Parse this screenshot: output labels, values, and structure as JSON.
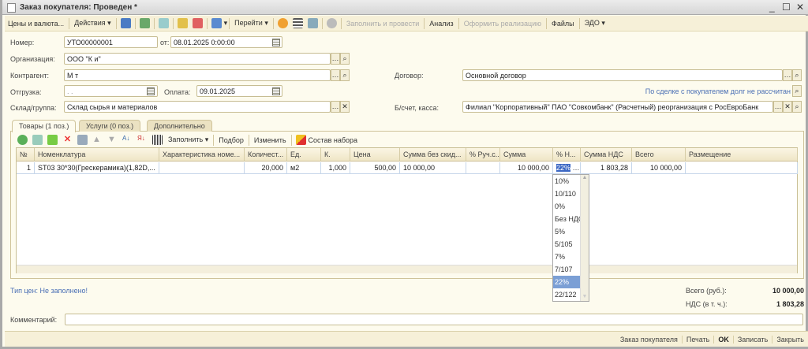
{
  "window": {
    "title": "Заказ покупателя: Проведен *",
    "minimize": "_",
    "maximize": "☐",
    "close": "✕"
  },
  "toolbar": {
    "prices": "Цены и валюта...",
    "actions": "Действия",
    "goto": "Перейти",
    "fill_post": "Заполнить и провести",
    "analysis": "Анализ",
    "make_sale": "Оформить реализацию",
    "files": "Файлы",
    "edo": "ЭДО"
  },
  "form": {
    "number_label": "Номер:",
    "number": "УТО00000001",
    "date_label": "от:",
    "date": "08.01.2025  0:00:00",
    "org_label": "Организация:",
    "org": "ООО \"К                              и\"",
    "contractor_label": "Контрагент:",
    "contractor": "М                       т",
    "contract_label": "Договор:",
    "contract": "Основной договор",
    "shipment_label": "Отгрузка:",
    "shipment": " .  .",
    "payment_label": "Оплата:",
    "payment": "09.01.2025",
    "debt_link": "По сделке с покупателем долг не рассчитан",
    "warehouse_label": "Склад/группа:",
    "warehouse": "Склад сырья и материалов",
    "account_label": "Б/счет, касса:",
    "account": "Филиал \"Корпоративный\" ПАО \"Совкомбанк\" (Расчетный) реорганизация с РосЕвроБанк"
  },
  "tabs": [
    {
      "label": "Товары (1 поз.)"
    },
    {
      "label": "Услуги (0 поз.)"
    },
    {
      "label": "Дополнительно"
    }
  ],
  "table_toolbar": {
    "fill": "Заполнить",
    "select": "Подбор",
    "change": "Изменить",
    "set": "Состав набора"
  },
  "table": {
    "columns": [
      "№",
      "Номенклатура",
      "Характеристика номе...",
      "Количест...",
      "Ед.",
      "К.",
      "Цена",
      "Сумма без скид...",
      "% Руч.с...",
      "Сумма",
      "% Н...",
      "Сумма НДС",
      "Всего",
      "Размещение"
    ],
    "rows": [
      [
        "1",
        "ST03 30*30(Грескерамика)(1,82D,...",
        "",
        "20,000",
        "м2",
        "1,000",
        "500,00",
        "10 000,00",
        "",
        "10 000,00",
        "22%",
        "1 803,28",
        "10 000,00",
        ""
      ]
    ]
  },
  "vat_dropdown": {
    "options": [
      "10%",
      "10/110",
      "0%",
      "Без НДС",
      "5%",
      "5/105",
      "7%",
      "7/107",
      "22%",
      "22/122"
    ],
    "selected": "22%"
  },
  "footer": {
    "price_type": "Тип цен: Не заполнено!",
    "total_label": "Всего (руб.):",
    "total": "10 000,00",
    "vat_label": "НДС (в т. ч.):",
    "vat": "1 803,28",
    "comment_label": "Комментарий:",
    "comment": ""
  },
  "bottom": {
    "order": "Заказ покупателя",
    "print": "Печать",
    "ok": "OK",
    "save": "Записать",
    "close": "Закрыть"
  }
}
